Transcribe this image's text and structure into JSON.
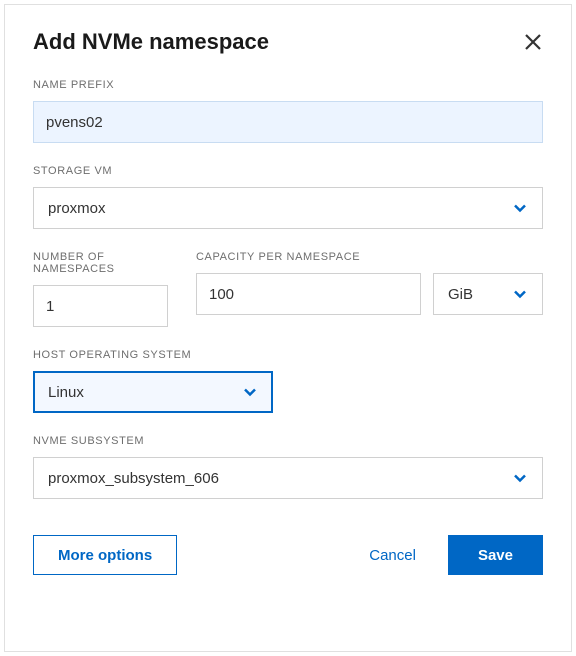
{
  "dialog": {
    "title": "Add NVMe namespace"
  },
  "fields": {
    "name_prefix": {
      "label": "NAME PREFIX",
      "value": "pvens02"
    },
    "storage_vm": {
      "label": "STORAGE VM",
      "value": "proxmox"
    },
    "num_namespaces": {
      "label": "NUMBER OF NAMESPACES",
      "value": "1"
    },
    "capacity": {
      "label": "CAPACITY PER NAMESPACE",
      "value": "100",
      "unit": "GiB"
    },
    "host_os": {
      "label": "HOST OPERATING SYSTEM",
      "value": "Linux"
    },
    "nvme_subsystem": {
      "label": "NVME SUBSYSTEM",
      "value": "proxmox_subsystem_606"
    }
  },
  "buttons": {
    "more_options": "More options",
    "cancel": "Cancel",
    "save": "Save"
  }
}
